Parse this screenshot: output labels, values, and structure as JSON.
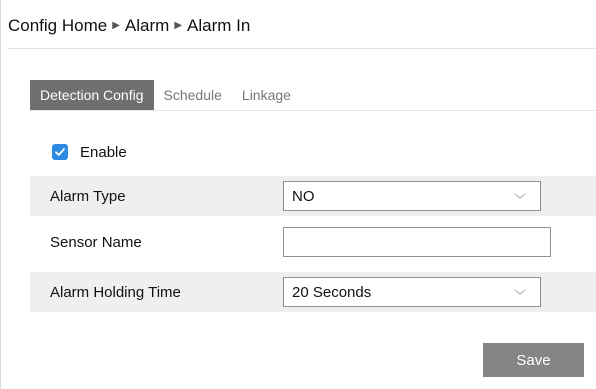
{
  "breadcrumb": {
    "items": [
      "Config Home",
      "Alarm",
      "Alarm In"
    ],
    "separator_icon": "triangle-right-icon"
  },
  "tabs": [
    {
      "label": "Detection Config",
      "active": true
    },
    {
      "label": "Schedule",
      "active": false
    },
    {
      "label": "Linkage",
      "active": false
    }
  ],
  "enable": {
    "label": "Enable",
    "checked": true
  },
  "fields": {
    "alarm_type": {
      "label": "Alarm Type",
      "value": "NO"
    },
    "sensor_name": {
      "label": "Sensor Name",
      "value": ""
    },
    "alarm_holding_time": {
      "label": "Alarm Holding Time",
      "value": "20 Seconds"
    }
  },
  "save_label": "Save",
  "colors": {
    "active_tab_bg": "#6f6f6f",
    "checkbox": "#2b8ae2",
    "save_button": "#858585",
    "row_shade": "#efefef"
  }
}
